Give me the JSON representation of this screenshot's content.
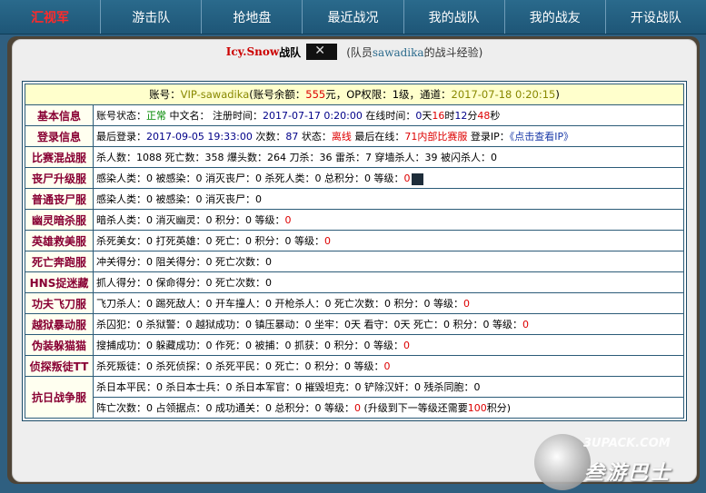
{
  "nav": [
    "汇视军",
    "游击队",
    "抢地盘",
    "最近战况",
    "我的战队",
    "我的战友",
    "开设战队"
  ],
  "team": {
    "name": "Icy.Snow",
    "suffix": "战队",
    "sub_prefix": "(队员",
    "member": "sawadika",
    "sub_suffix": "的战斗经验)"
  },
  "account": {
    "l1": "账号：",
    "id": "VIP-sawadika",
    "l2": "(账号余额：",
    "balance": "555",
    "l3": "元，OP权限：1级，通道：",
    "date": "2017-07-18 0:20:15",
    "l4": ")"
  },
  "basic": {
    "cat": "基本信息",
    "l1": "账号状态：",
    "status": "正常",
    "l2": " 中文名： 注册时间：",
    "reg": "2017-07-17 0:20:00",
    "l3": " 在线时间：",
    "d": "0",
    "l4": "天",
    "h": "16",
    "l5": "时",
    "m": "12",
    "l6": "分",
    "s": "48",
    "l7": "秒"
  },
  "login": {
    "cat": "登录信息",
    "l1": "最后登录：",
    "last": "2017-09-05 19:33:00",
    "l2": " 次数：",
    "count": "87",
    "l3": " 状态：",
    "state": "离线",
    "l4": " 最后在线：",
    "server": "71内部比赛服",
    "l5": " 登录IP：",
    "ip": "《点击查看IP》"
  },
  "rows": [
    {
      "cat": "比赛混战服",
      "text": "杀人数：1088 死亡数：358 爆头数：264 刀杀：36 雷杀：7 穿墙杀人：39 被闪杀人：0"
    },
    {
      "cat": "丧尸升级服",
      "text": "感染人类：0 被感染：0 消灭丧尸：0 杀死人类：0 总积分：0 等级：",
      "tail": "0"
    },
    {
      "cat": "普通丧尸服",
      "text": "感染人类：0 被感染：0 消灭丧尸：0"
    },
    {
      "cat": "幽灵暗杀服",
      "text": "暗杀人类：0 消灭幽灵：0 积分：0 等级：",
      "tail": "0"
    },
    {
      "cat": "英雄救美服",
      "text": "杀死美女：0 打死英雄：0 死亡：0 积分：0 等级：",
      "tail": "0"
    },
    {
      "cat": "死亡奔跑服",
      "text": "冲关得分：0 阻关得分：0 死亡次数：0"
    },
    {
      "cat": "HNS捉迷藏",
      "text": "抓人得分：0 保命得分：0 死亡次数：0"
    },
    {
      "cat": "功夫飞刀服",
      "text": "飞刀杀人：0 踢死敌人：0 开车撞人：0 开枪杀人：0 死亡次数：0 积分：0 等级：",
      "tail": "0"
    },
    {
      "cat": "越狱暴动服",
      "text": "杀囚犯：0 杀狱警：0 越狱成功：0 镇压暴动：0 坐牢：0天 看守：0天 死亡：0 积分：0 等级：",
      "tail": "0"
    },
    {
      "cat": "伪装躲猫猫",
      "text": "搜捕成功：0 躲藏成功：0 作死：0 被捕：0 抓获：0 积分：0 等级：",
      "tail": "0"
    },
    {
      "cat": "侦探叛徒TT",
      "text": "杀死叛徒：0 杀死侦探：0 杀死平民：0 死亡：0 积分：0 等级：",
      "tail": "0"
    }
  ],
  "kr": {
    "cat": "抗日战争服",
    "line1": "杀日本平民：0 杀日本士兵：0 杀日本军官：0 摧毁坦克：0 铲除汉奸：0 残杀同胞：0",
    "line2a": "阵亡次数：0 占领据点：0 成功通关：0 总积分：0 等级：",
    "lv": "0",
    "line2b": " (升级到下一等级还需要",
    "need": "100",
    "line2c": "积分)"
  },
  "watermark": {
    "t1": "3UPACK.COM",
    "t2": "叁游巴士"
  }
}
